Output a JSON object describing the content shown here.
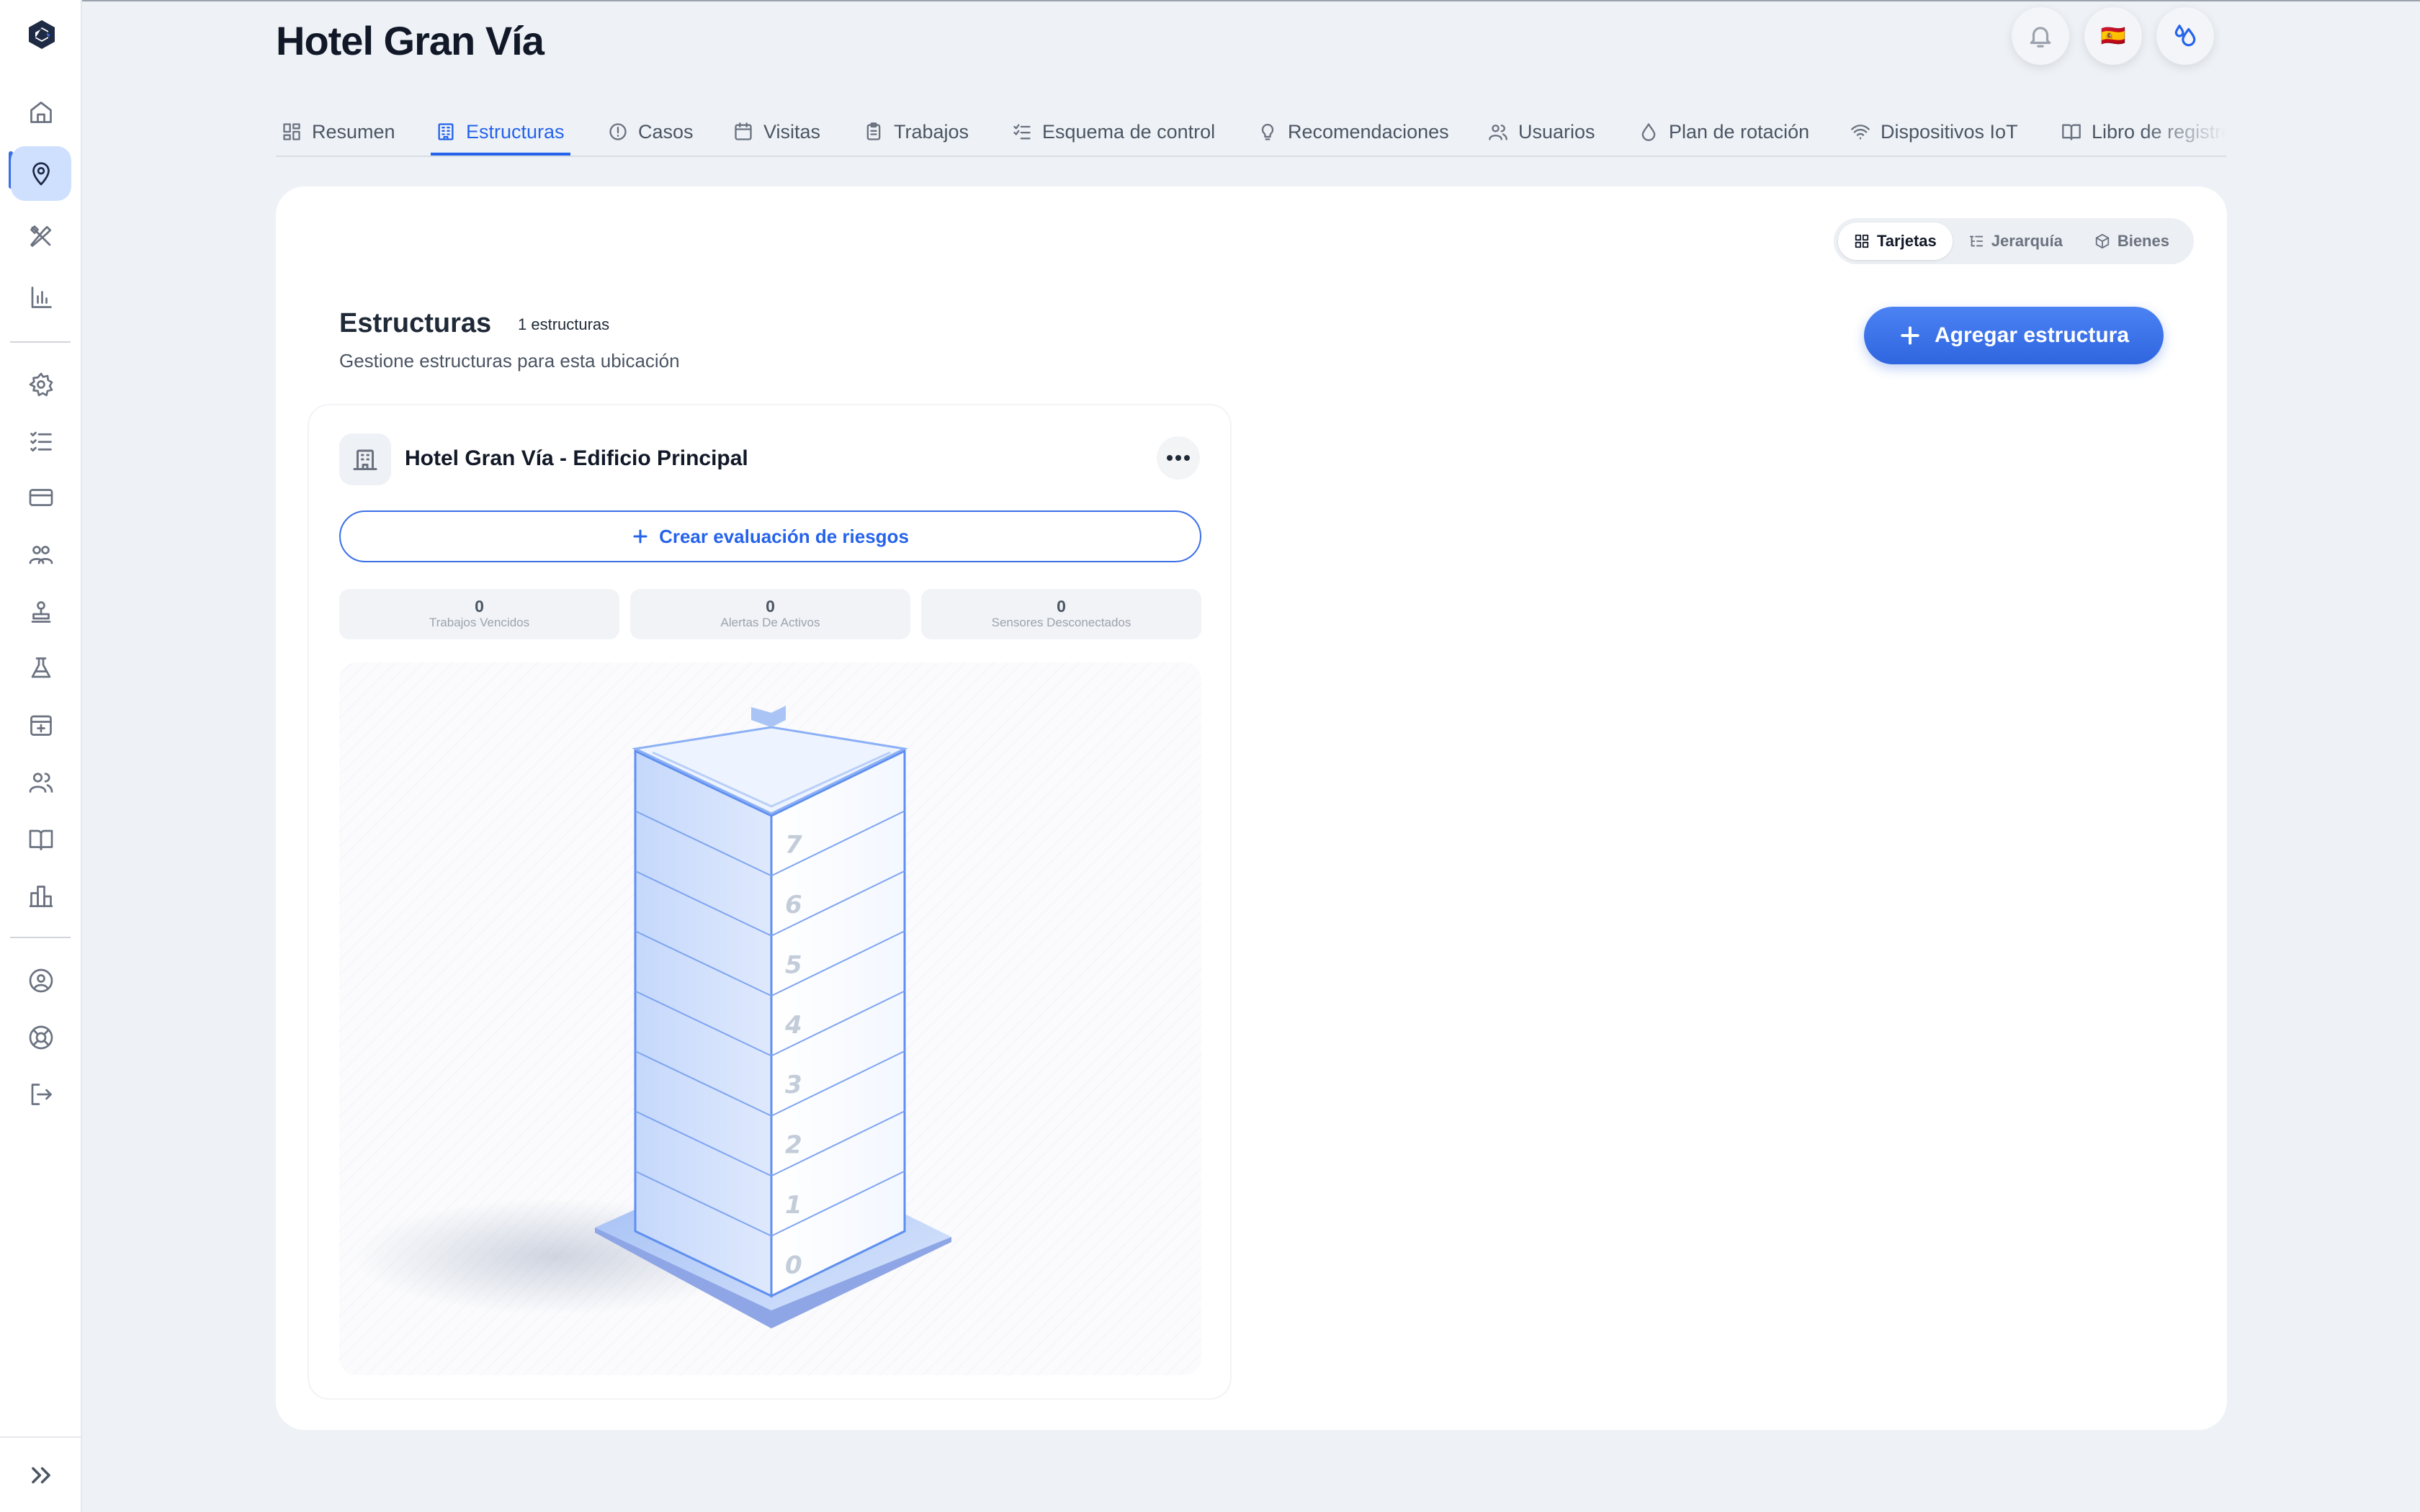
{
  "page": {
    "title": "Hotel Gran Vía"
  },
  "header": {
    "language_flag": "🇪🇸",
    "accent_color": "#2563eb"
  },
  "tabs": [
    {
      "label": "Resumen",
      "icon": "grid-icon"
    },
    {
      "label": "Estructuras",
      "icon": "building-icon",
      "active": true
    },
    {
      "label": "Casos",
      "icon": "alert-circle-icon"
    },
    {
      "label": "Visitas",
      "icon": "calendar-icon"
    },
    {
      "label": "Trabajos",
      "icon": "clipboard-icon"
    },
    {
      "label": "Esquema de control",
      "icon": "checklist-icon"
    },
    {
      "label": "Recomendaciones",
      "icon": "lightbulb-icon"
    },
    {
      "label": "Usuarios",
      "icon": "users-icon"
    },
    {
      "label": "Plan de rotación",
      "icon": "droplet-icon"
    },
    {
      "label": "Dispositivos IoT",
      "icon": "wifi-icon"
    },
    {
      "label": "Libro de registro",
      "icon": "book-icon"
    }
  ],
  "view_toggle": {
    "cards": "Tarjetas",
    "hierarchy": "Jerarquía",
    "assets": "Bienes"
  },
  "section": {
    "title": "Estructuras",
    "count": "1 estructuras",
    "subtitle": "Gestione estructuras para esta ubicación",
    "add_button": "Agregar estructura"
  },
  "structure": {
    "name": "Hotel Gran Vía - Edificio Principal",
    "risk_button": "Crear evaluación de riesgos",
    "stats": [
      {
        "value": "0",
        "label": "Trabajos Vencidos"
      },
      {
        "value": "0",
        "label": "Alertas De Activos"
      },
      {
        "value": "0",
        "label": "Sensores Desconectados"
      }
    ],
    "floors": [
      "7",
      "6",
      "5",
      "4",
      "3",
      "2",
      "1",
      "0"
    ]
  }
}
